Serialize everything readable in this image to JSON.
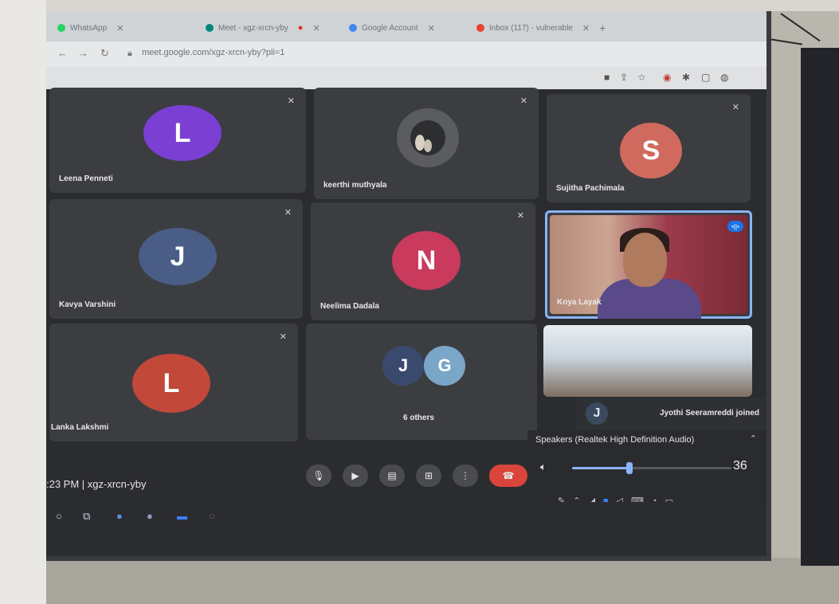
{
  "browser": {
    "tabs": [
      {
        "label": "WhatsApp",
        "color": "#25d366"
      },
      {
        "label": "Meet - xgz-xrcn-yby",
        "color": "#00897b"
      },
      {
        "label": "Google Account",
        "color": "#4285f4"
      },
      {
        "label": "Inbox (117) - vulnerable",
        "color": "#ea4335"
      }
    ],
    "url": "meet.google.com/xgz-xrcn-yby?pli=1"
  },
  "participants": [
    {
      "name": "Leena Penneti",
      "initial": "L",
      "color": "#7b3fd4",
      "muted": true
    },
    {
      "name": "keerthi muthyala",
      "initial": "",
      "color": "#5a5c5f",
      "muted": true
    },
    {
      "name": "Sujitha Pachimala",
      "initial": "S",
      "color": "#d06a5f",
      "muted": true
    },
    {
      "name": "Kavya Varshini",
      "initial": "J",
      "color": "#4a5d86",
      "muted": true
    },
    {
      "name": "Neelima Dadala",
      "initial": "N",
      "color": "#c93a5d",
      "muted": true
    },
    {
      "name": "Koya Layak",
      "initial": "",
      "color": "#1a73e8",
      "muted": false
    },
    {
      "name": "Lanka Lakshmi",
      "initial": "L",
      "color": "#c2483a",
      "muted": true
    },
    {
      "name": "6 others",
      "initial": "J",
      "color": "#3a4a6e",
      "initial2": "G",
      "color2": "#7aa6c8",
      "muted": false
    }
  ],
  "notification": {
    "initial": "J",
    "text": "Jyothi Seeramreddi joined"
  },
  "volume": {
    "device": "Speakers (Realtek High Definition Audio)",
    "level": 36
  },
  "meeting": {
    "info": ":23 PM  |  xgz-xrcn-yby"
  }
}
